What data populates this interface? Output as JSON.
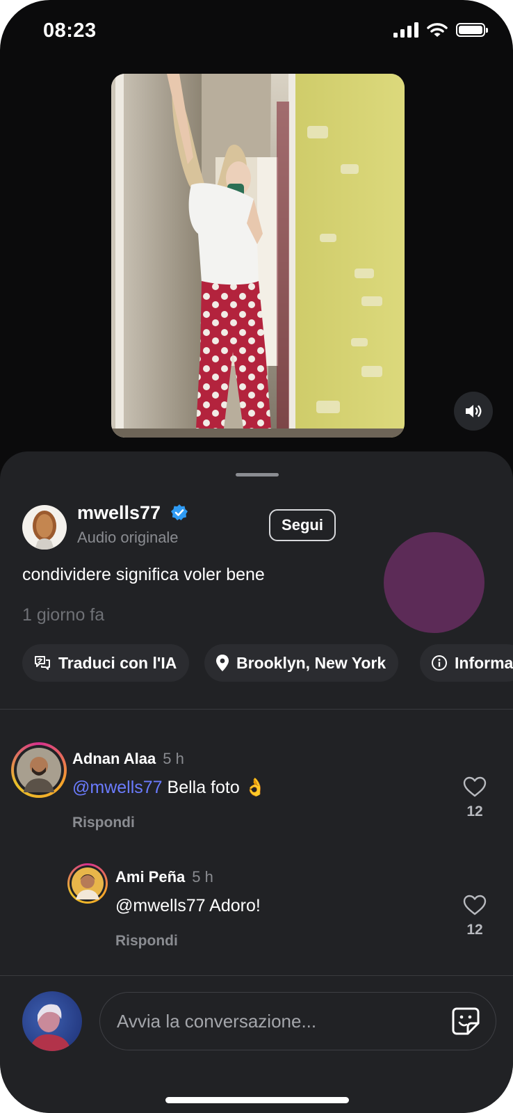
{
  "status_bar": {
    "time": "08:23"
  },
  "post": {
    "username": "mwells77",
    "verified": true,
    "audio": "Audio originale",
    "follow_label": "Segui",
    "caption": "condividere significa voler bene",
    "time_ago": "1 giorno fa",
    "chips": [
      {
        "label": "Traduci con l'IA",
        "icon": "translate-icon"
      },
      {
        "label": "Brooklyn, New York",
        "icon": "location-pin-icon"
      },
      {
        "label": "Informa",
        "icon": "info-icon"
      }
    ]
  },
  "comments": [
    {
      "author": "Adnan Alaa",
      "time": "5 h",
      "mention": "@mwells77",
      "text": " Bella foto 👌",
      "reply_label": "Rispondi",
      "likes": "12"
    },
    {
      "author": "Ami Peña",
      "time": "5 h",
      "text": "@mwells77 Adoro!",
      "reply_label": "Rispondi",
      "likes": "12"
    }
  ],
  "composer": {
    "placeholder": "Avvia la conversazione..."
  },
  "colors": {
    "background": "#0b0b0c",
    "sheet": "#212225",
    "chip": "#2b2c30",
    "mention": "#6b7cff",
    "verified": "#2f9bf4",
    "accent_dot": "#5c2b57"
  }
}
